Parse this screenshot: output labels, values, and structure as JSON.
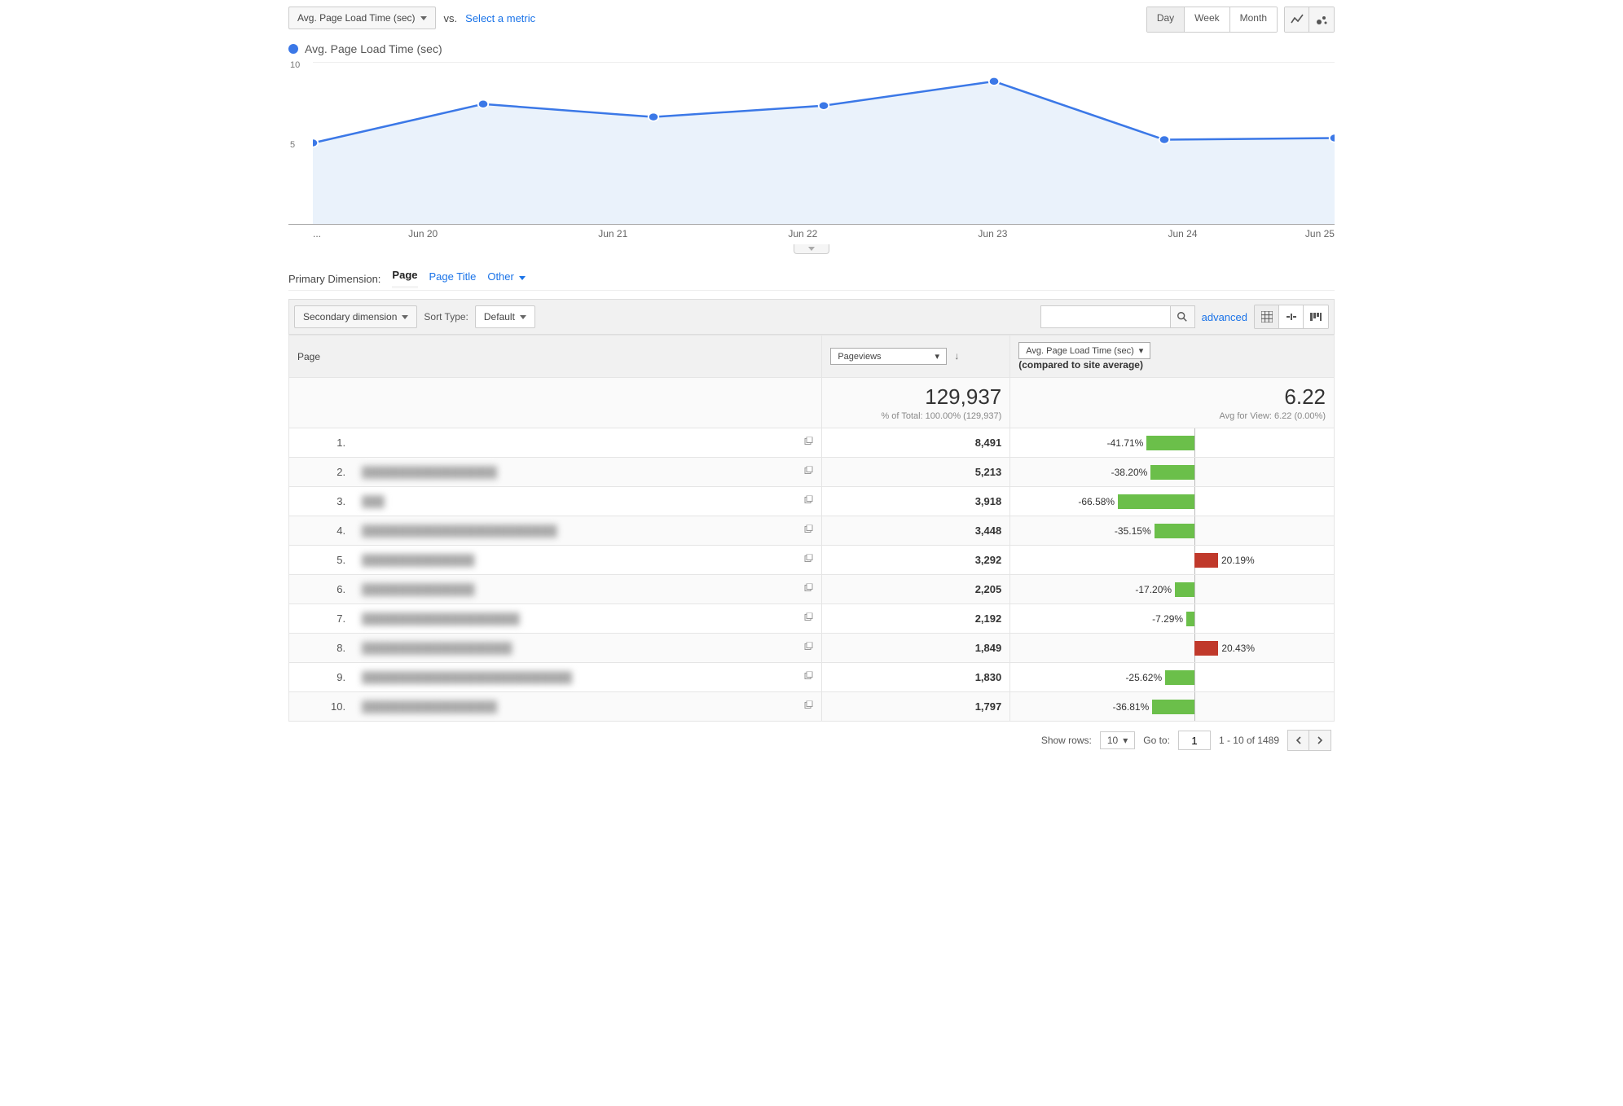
{
  "controls": {
    "primary_metric": "Avg. Page Load Time (sec)",
    "vs_label": "vs.",
    "select_metric_link": "Select a metric",
    "time_toggle": {
      "day": "Day",
      "week": "Week",
      "month": "Month",
      "active": "Day"
    }
  },
  "legend": {
    "series_name": "Avg. Page Load Time (sec)"
  },
  "chart_data": {
    "type": "line",
    "x": [
      "...",
      "Jun 20",
      "Jun 21",
      "Jun 22",
      "Jun 23",
      "Jun 24",
      "Jun 25"
    ],
    "values": [
      5.0,
      7.4,
      6.6,
      7.3,
      8.8,
      5.2,
      5.3
    ],
    "ylim": [
      0,
      10
    ],
    "y_ticks": [
      5,
      10
    ],
    "title": "Avg. Page Load Time (sec)",
    "ylabel": "",
    "xlabel": ""
  },
  "primary_dimension": {
    "label": "Primary Dimension:",
    "active": "Page",
    "tabs": [
      "Page",
      "Page Title",
      "Other"
    ]
  },
  "toolbar": {
    "secondary_dimension": "Secondary dimension",
    "sort_type_label": "Sort Type:",
    "sort_type_value": "Default",
    "advanced_link": "advanced",
    "search_placeholder": ""
  },
  "table": {
    "columns": {
      "page": "Page",
      "pageviews_select": "Pageviews",
      "avg_select": "Avg. Page Load Time (sec)",
      "avg_subheader": "(compared to site average)"
    },
    "summary": {
      "pageviews_total": "129,937",
      "pageviews_sub": "% of Total: 100.00% (129,937)",
      "avg_total": "6.22",
      "avg_sub": "Avg for View: 6.22 (0.00%)"
    },
    "rows": [
      {
        "idx": "1.",
        "page_blur": "",
        "pageviews": "8,491",
        "cmp_pct": -41.71,
        "cmp_label": "-41.71%"
      },
      {
        "idx": "2.",
        "page_blur": "██████████████████",
        "pageviews": "5,213",
        "cmp_pct": -38.2,
        "cmp_label": "-38.20%"
      },
      {
        "idx": "3.",
        "page_blur": "███",
        "pageviews": "3,918",
        "cmp_pct": -66.58,
        "cmp_label": "-66.58%"
      },
      {
        "idx": "4.",
        "page_blur": "██████████████████████████",
        "pageviews": "3,448",
        "cmp_pct": -35.15,
        "cmp_label": "-35.15%"
      },
      {
        "idx": "5.",
        "page_blur": "███████████████",
        "pageviews": "3,292",
        "cmp_pct": 20.19,
        "cmp_label": "20.19%"
      },
      {
        "idx": "6.",
        "page_blur": "███████████████",
        "pageviews": "2,205",
        "cmp_pct": -17.2,
        "cmp_label": "-17.20%"
      },
      {
        "idx": "7.",
        "page_blur": "█████████████████████",
        "pageviews": "2,192",
        "cmp_pct": -7.29,
        "cmp_label": "-7.29%"
      },
      {
        "idx": "8.",
        "page_blur": "████████████████████",
        "pageviews": "1,849",
        "cmp_pct": 20.43,
        "cmp_label": "20.43%"
      },
      {
        "idx": "9.",
        "page_blur": "████████████████████████████",
        "pageviews": "1,830",
        "cmp_pct": -25.62,
        "cmp_label": "-25.62%"
      },
      {
        "idx": "10.",
        "page_blur": "██████████████████",
        "pageviews": "1,797",
        "cmp_pct": -36.81,
        "cmp_label": "-36.81%"
      }
    ]
  },
  "pagination": {
    "show_rows_label": "Show rows:",
    "show_rows_value": "10",
    "goto_label": "Go to:",
    "goto_value": "1",
    "range": "1 - 10 of 1489"
  }
}
